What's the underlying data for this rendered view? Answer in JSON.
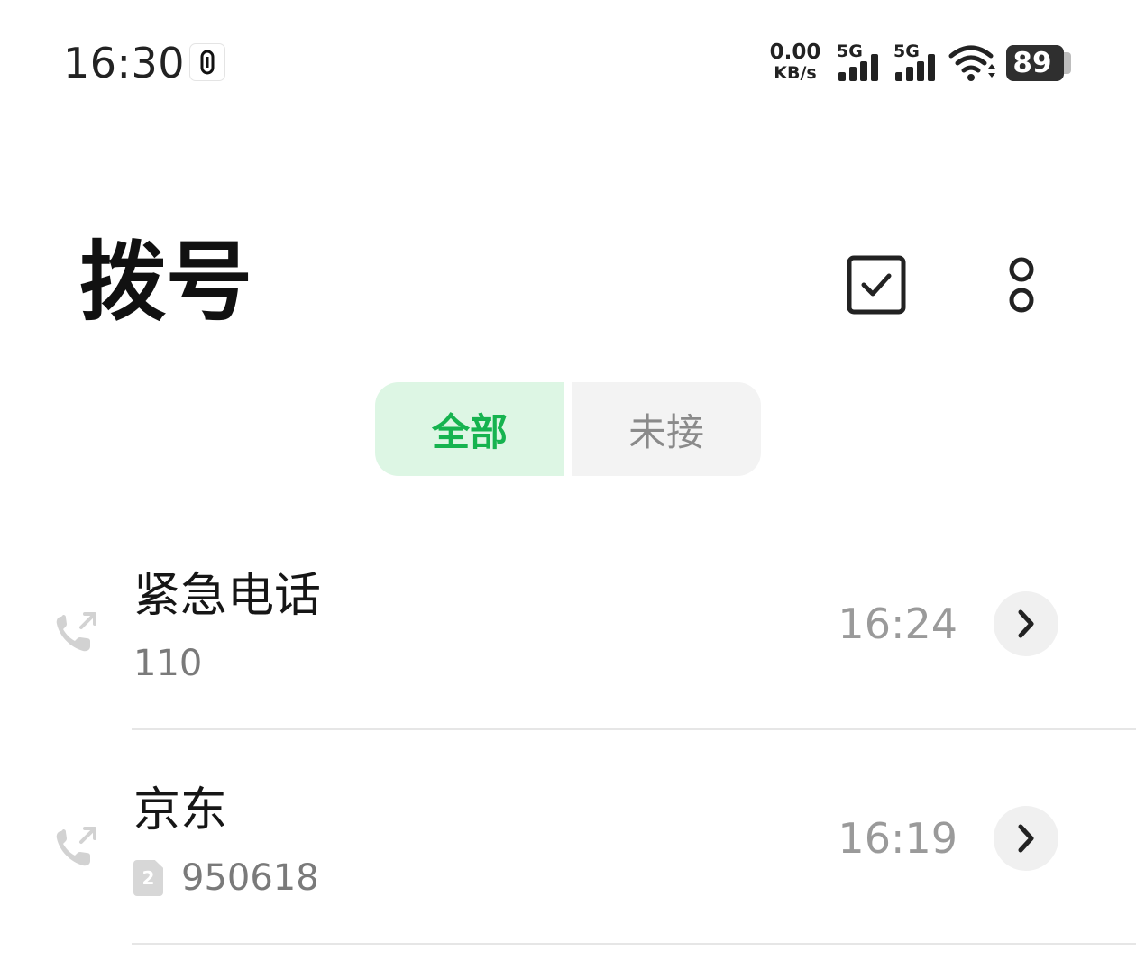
{
  "status_bar": {
    "time": "16:30",
    "net_speed_value": "0.00",
    "net_speed_unit": "KB/s",
    "sim1_label": "5G",
    "sim2_label": "5G",
    "battery_level": "89",
    "icons": [
      "ai-assistant-badge-icon",
      "signal-icon",
      "wifi-icon",
      "battery-icon"
    ]
  },
  "header": {
    "title": "拨号",
    "actions": [
      "multi-select-icon",
      "more-options-icon"
    ]
  },
  "tabs": [
    {
      "label": "全部",
      "selected": true
    },
    {
      "label": "未接",
      "selected": false
    }
  ],
  "calls": [
    {
      "name": "紧急电话",
      "number": "110",
      "time": "16:24",
      "sim": "",
      "type_icon": "outgoing-call-icon"
    },
    {
      "name": "京东",
      "number": "950618",
      "time": "16:19",
      "sim": "2",
      "type_icon": "outgoing-call-icon"
    }
  ],
  "colors": {
    "accent_green": "#16b34f",
    "selected_tab_bg": "#ddf6e4",
    "unselected_tab_bg": "#f3f3f3",
    "secondary_text": "#9a9a9a"
  }
}
